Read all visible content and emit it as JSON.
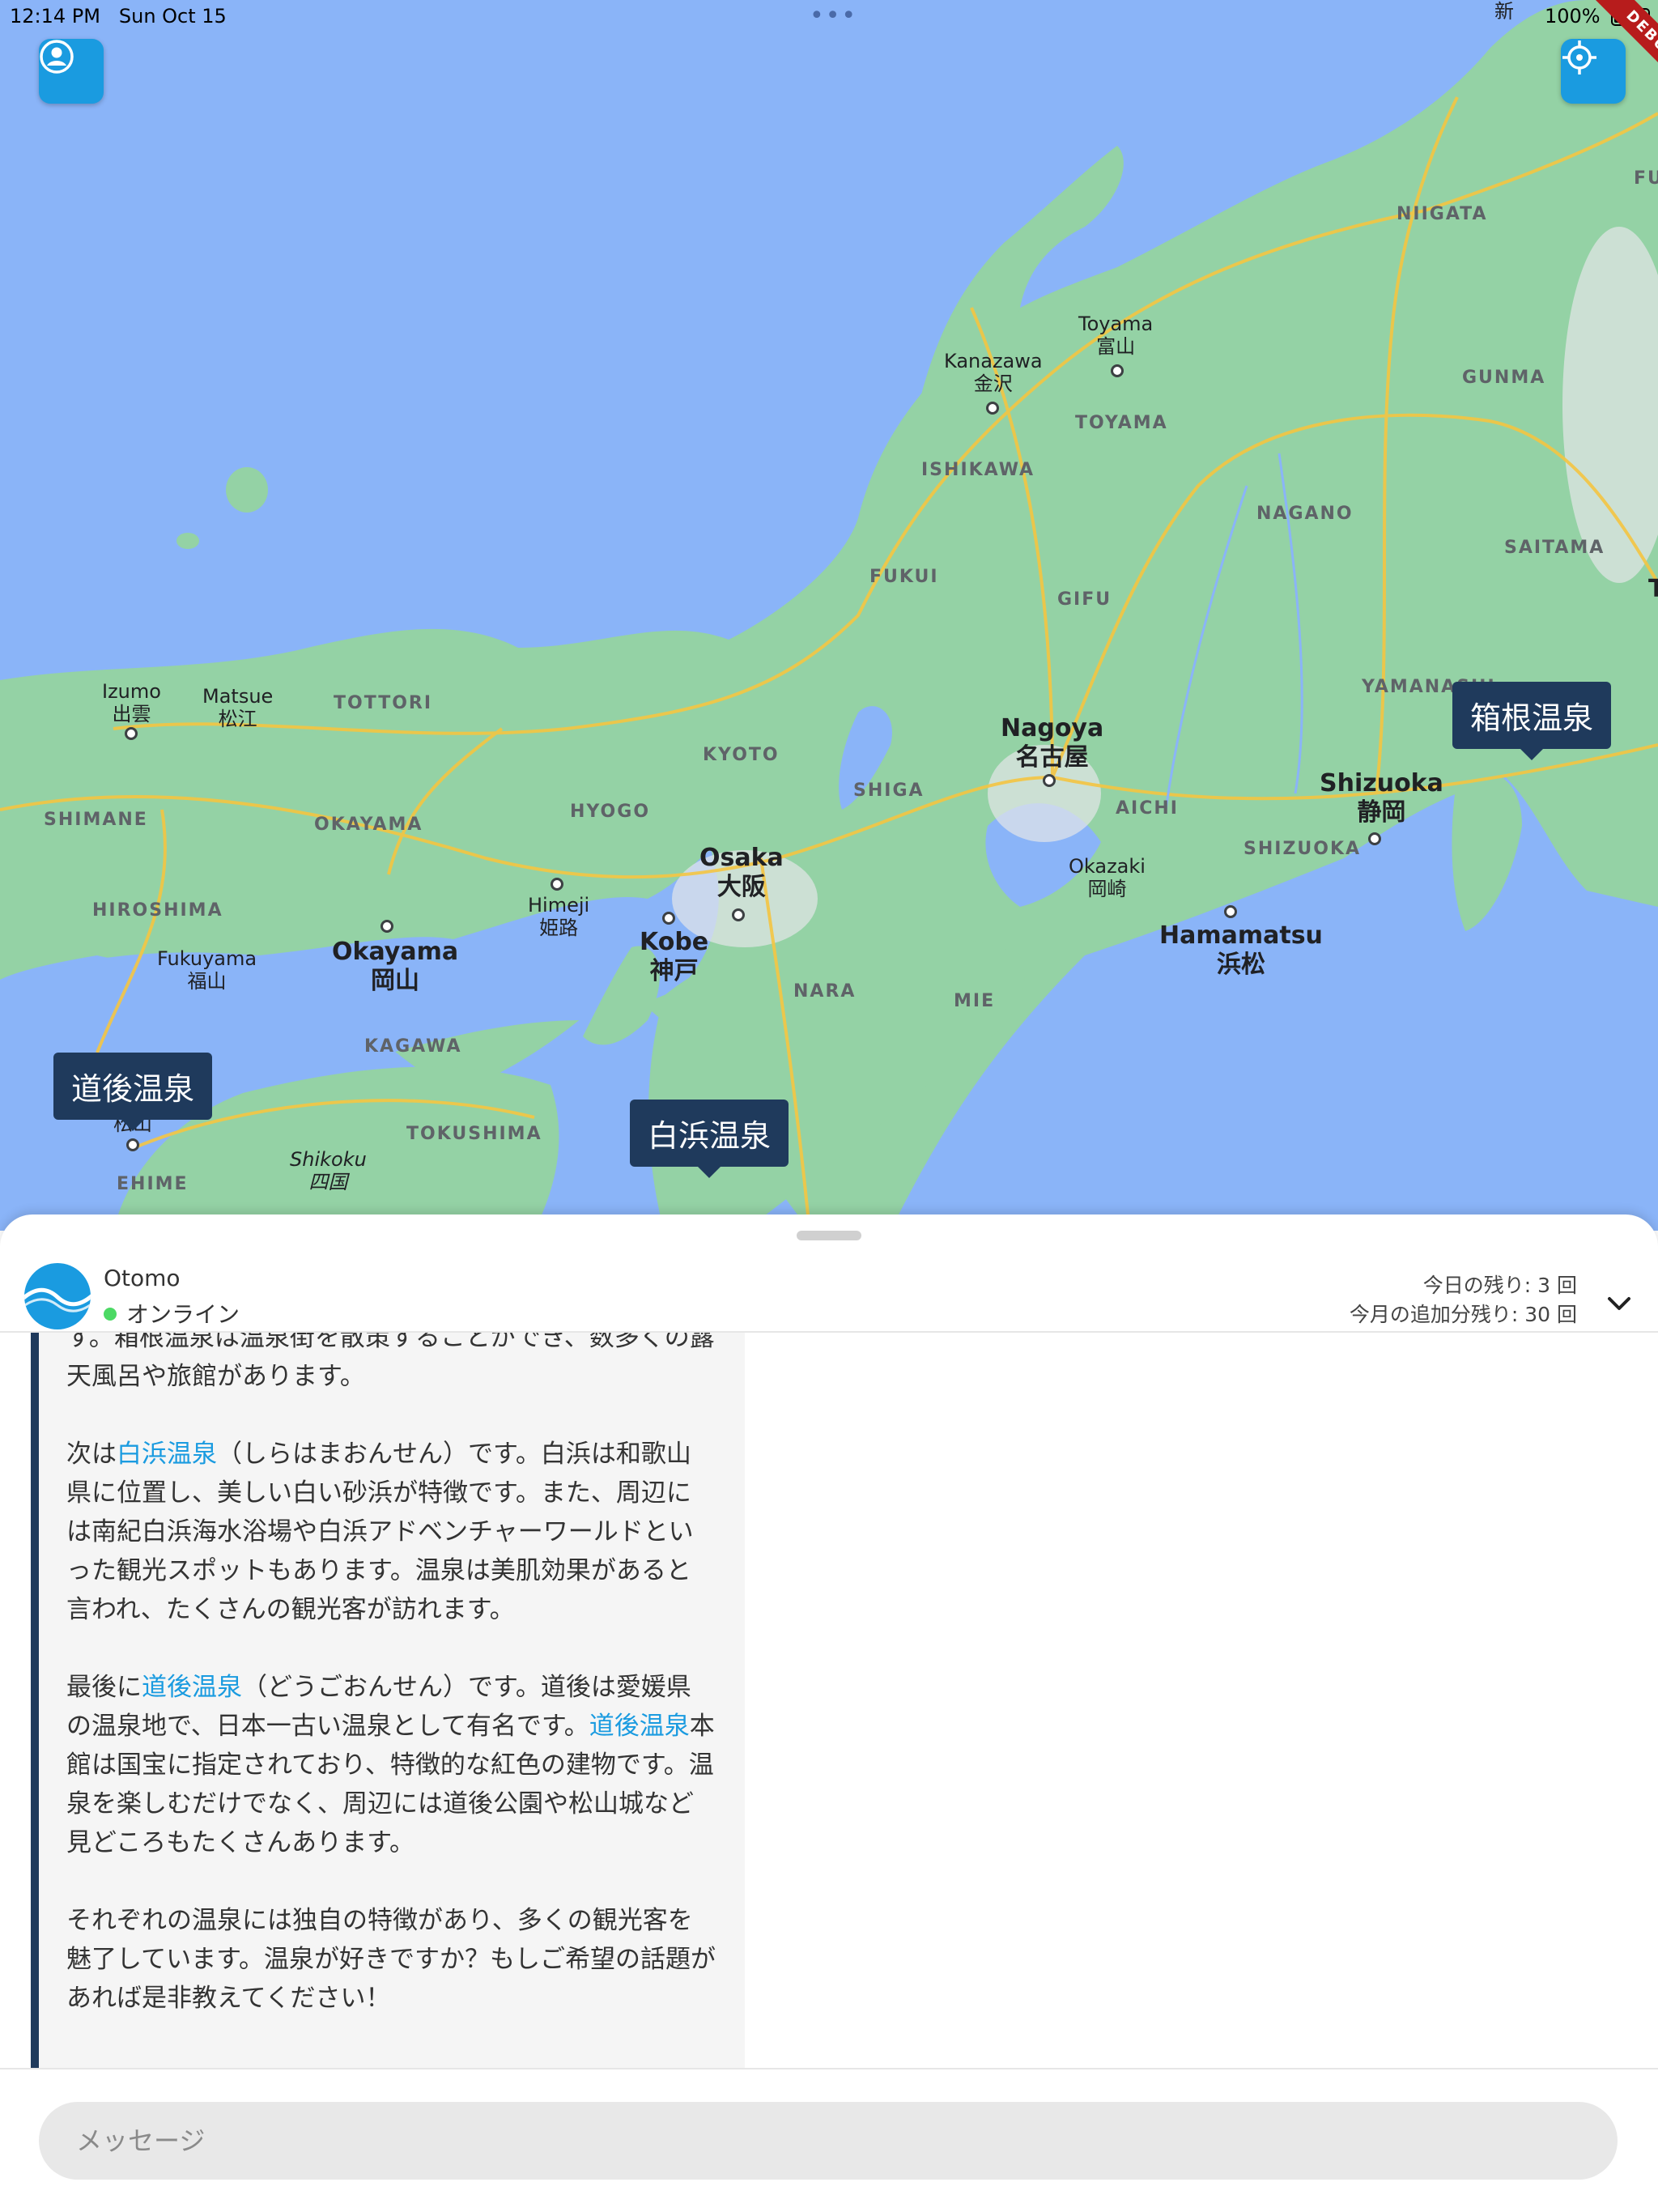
{
  "status_bar": {
    "time": "12:14 PM",
    "date": "Sun Oct 15",
    "battery": "100%",
    "debug_label": "DEBUG"
  },
  "map": {
    "prefectures": [
      "NIIGATA",
      "TOYAMA",
      "GUNMA",
      "ISHIKAWA",
      "NAGANO",
      "FUKUI",
      "GIFU",
      "SAITAMA",
      "TOTTORI",
      "KYOTO",
      "SHIMANE",
      "OKAYAMA",
      "HYOGO",
      "SHIGA",
      "AICHI",
      "SHIZUOKA",
      "YAMANASHI",
      "HIROSHIMA",
      "NARA",
      "MIE",
      "KAGAWA",
      "TOKUSHIMA",
      "EHIME"
    ],
    "cities": [
      {
        "en": "Toyama",
        "jp": "富山"
      },
      {
        "en": "Kanazawa",
        "jp": "金沢"
      },
      {
        "en": "Izumo",
        "jp": "出雲"
      },
      {
        "en": "Matsue",
        "jp": "松江"
      },
      {
        "en": "Nagoya",
        "jp": "名古屋"
      },
      {
        "en": "Shizuoka",
        "jp": "静岡"
      },
      {
        "en": "Osaka",
        "jp": "大阪"
      },
      {
        "en": "Himeji",
        "jp": "姫路"
      },
      {
        "en": "Kobe",
        "jp": "神戸"
      },
      {
        "en": "Okazaki",
        "jp": "岡崎"
      },
      {
        "en": "Hamamatsu",
        "jp": "浜松"
      },
      {
        "en": "Fukuyama",
        "jp": "福山"
      },
      {
        "en": "Okayama",
        "jp": "岡山"
      },
      {
        "en": "Shikoku",
        "jp": "四国"
      }
    ],
    "fragments": [
      "新",
      "FU",
      "T",
      "松山"
    ],
    "markers": [
      "箱根温泉",
      "道後温泉",
      "白浜温泉"
    ]
  },
  "chat_header": {
    "name": "Otomo",
    "status": "オンライン",
    "quota_today": "今日の残り: 3 回",
    "quota_month": "今月の追加分残り: 30 回"
  },
  "message": {
    "p0": "す。箱根温泉は温泉街を散策することができ、数多くの露天風呂や旅館があります。",
    "p1": [
      "次は",
      "白浜温泉",
      "（しらはまおんせん）です。白浜は和歌山県に位置し、美しい白い砂浜が特徴です。また、周辺には南紀白浜海水浴場や白浜アドベンチャーワールドといった観光スポットもあります。温泉は美肌効果があると言われ、たくさんの観光客が訪れます。"
    ],
    "p2": [
      "最後に",
      "道後温泉",
      "（どうごおんせん）です。道後は愛媛県の温泉地で、日本一古い温泉として有名です。",
      "道後温泉",
      "本館は国宝に指定されており、特徴的な紅色の建物です。温泉を楽しむだけでなく、周辺には道後公園や松山城など見どころもたくさんあります。"
    ],
    "p3": "それぞれの温泉には独自の特徴があり、多くの観光客を魅了しています。温泉が好きですか？もしご希望の話題があれば是非教えてください！"
  },
  "composer": {
    "placeholder": "メッセージ"
  },
  "colors": {
    "accent": "#1a9be0",
    "marker": "#1f3a5c",
    "water": "#8ab4f8",
    "land": "#94d2a5",
    "road": "#f4c542",
    "online": "#4cd964"
  }
}
